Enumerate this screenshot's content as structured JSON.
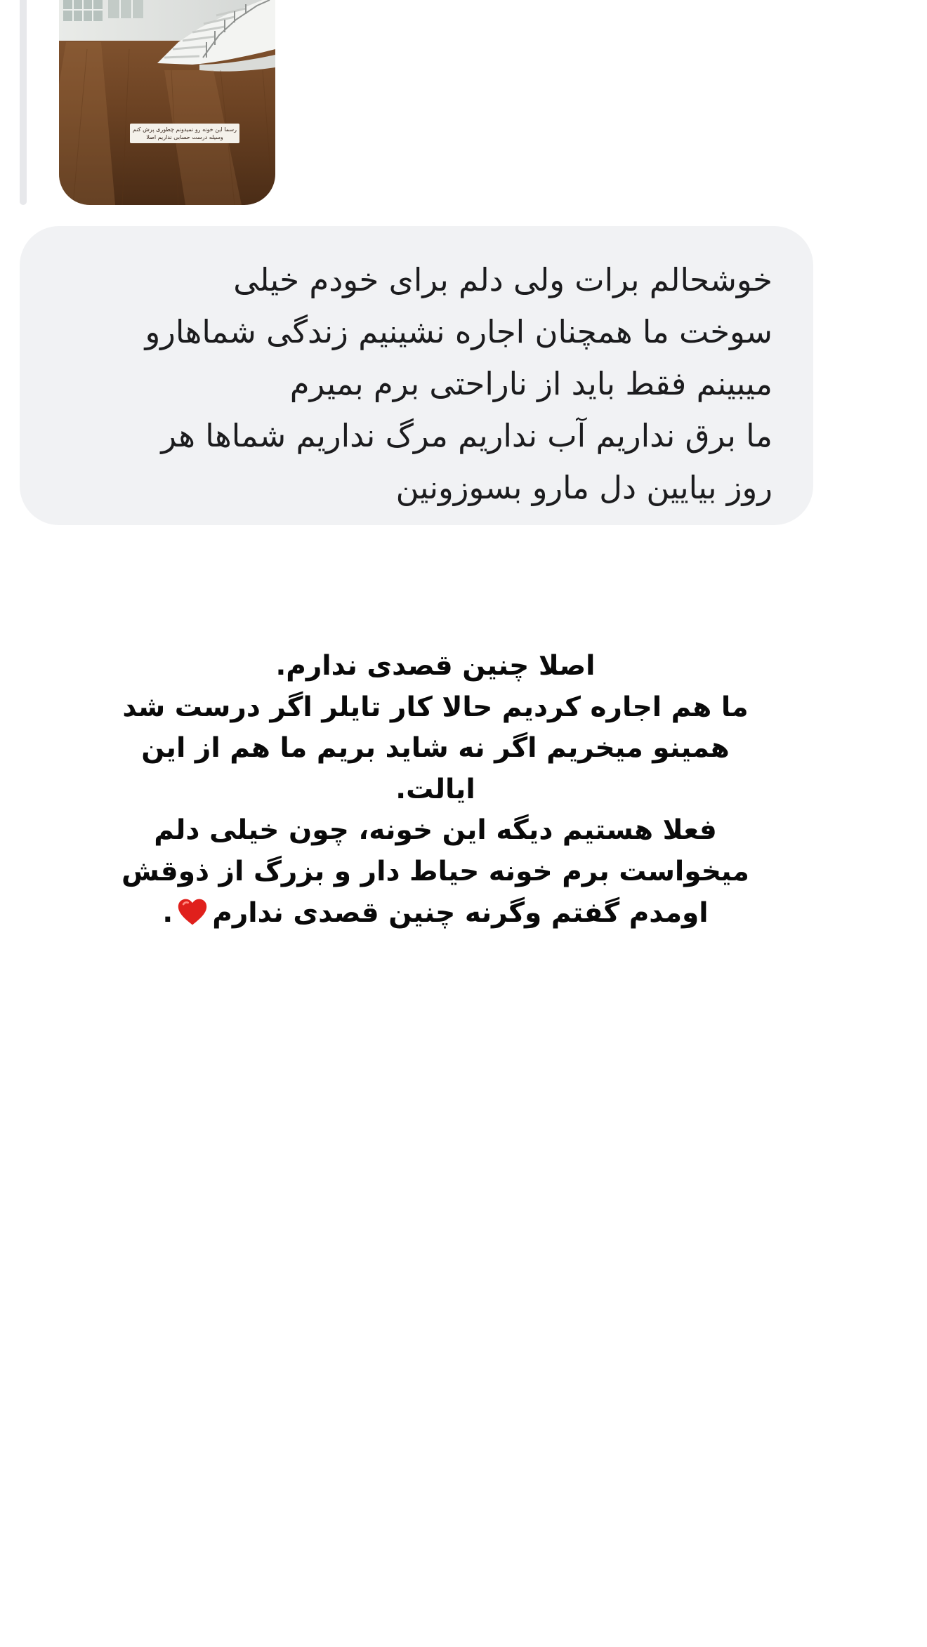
{
  "story_reply": {
    "thumbnail_caption": [
      "رسما این خونه رو نمیدونم چطوری پرش کنم",
      "وسیله درست حسابی نداریم اصلا"
    ]
  },
  "message": {
    "lines": [
      "خوشحالم برات ولی دلم برای خودم خیلی",
      "سوخت ما همچنان اجاره نشینیم زندگی شماهارو",
      "میبینم فقط باید از ناراحتی برم بمیرم",
      "ما برق نداریم آب نداریم مرگ نداریم شماها هر",
      "روز بیایین دل مارو بسوزونین"
    ]
  },
  "reply_caption": {
    "lines": [
      "اصلا چنین قصدی ندارم.",
      "ما هم اجاره کردیم حالا کار تایلر اگر درست شد",
      "همینو میخریم اگر نه شاید بریم ما هم از این",
      "ایالت.",
      "فعلا هستیم دیگه این خونه، چون خیلی دلم",
      "میخواست برم خونه حیاط دار و بزرگ از ذوقش",
      "اومدم گفتم وگرنه چنین قصدی ندارم"
    ],
    "ending_punctuation": ".",
    "emoji_icon": "red-heart-icon",
    "heart_color": "#e0201c"
  },
  "colors": {
    "bubble_background": "#f1f2f4",
    "reply_bar": "#e7e8eb",
    "text_primary": "#1c1c1e"
  }
}
